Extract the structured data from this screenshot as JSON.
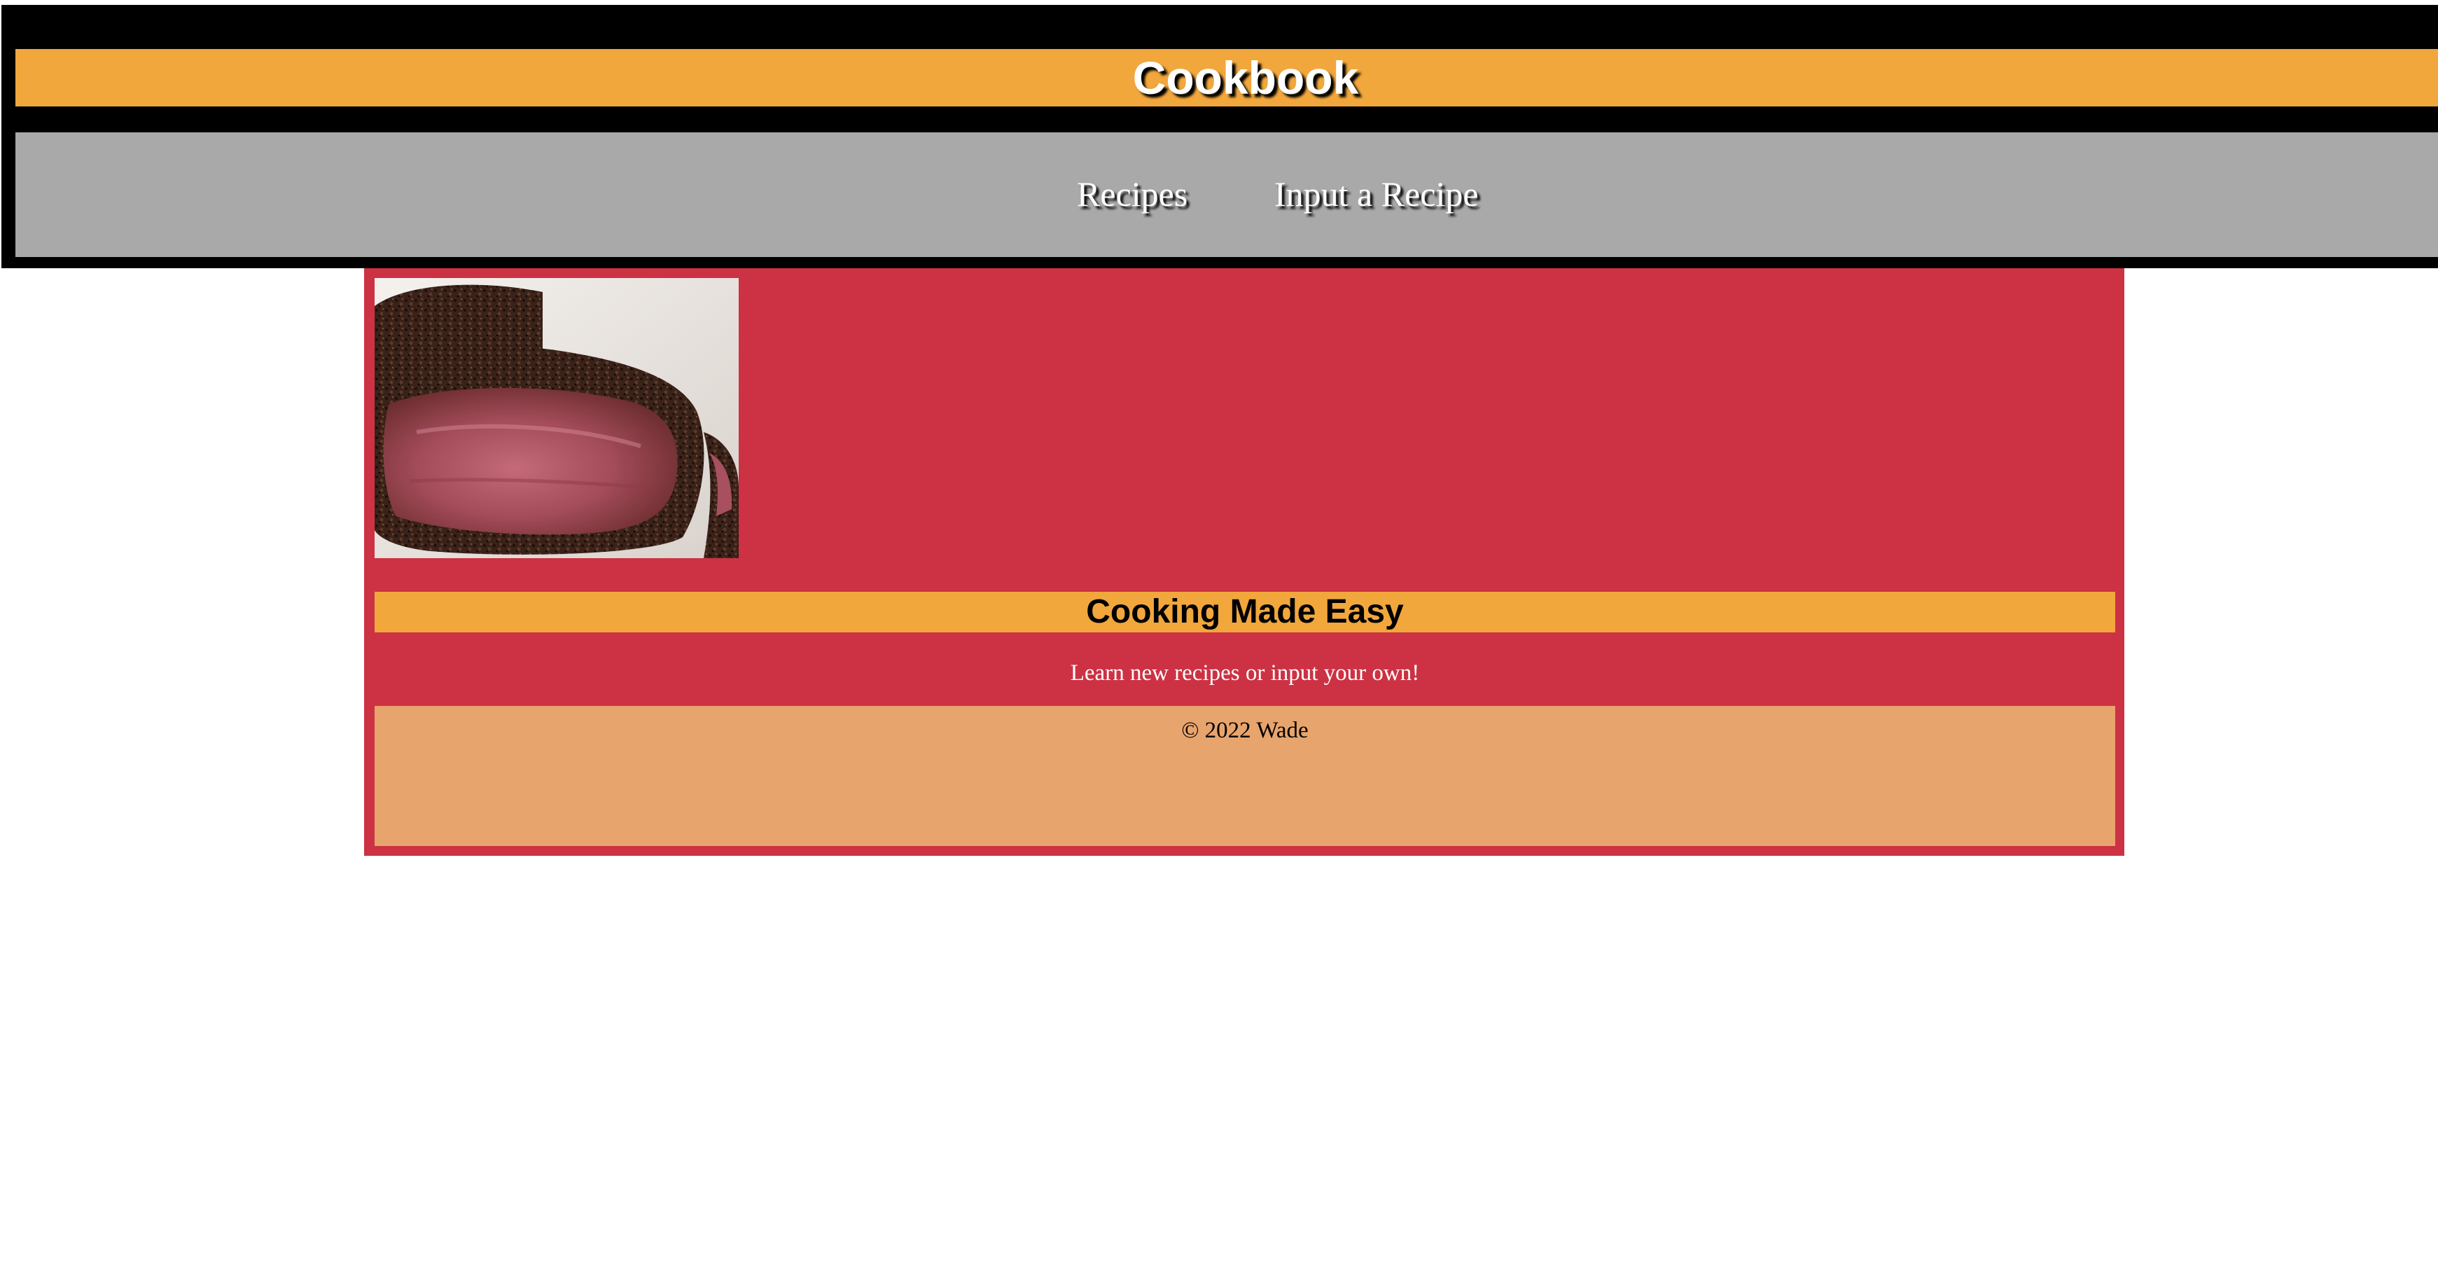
{
  "header": {
    "title": "Cookbook",
    "nav": [
      {
        "label": "Recipes"
      },
      {
        "label": "Input a Recipe"
      }
    ]
  },
  "main": {
    "hero_image": "seared-steak-photo",
    "tagline": "Cooking Made Easy",
    "intro": "Learn new recipes or input your own!"
  },
  "footer": {
    "copyright": "© 2022 Wade"
  },
  "colors": {
    "header_bg": "#000000",
    "title_bar": "#f1a73c",
    "nav_bg": "#a9a9a9",
    "main_bg": "#cc3243",
    "footer_bg": "#e8a46d"
  }
}
